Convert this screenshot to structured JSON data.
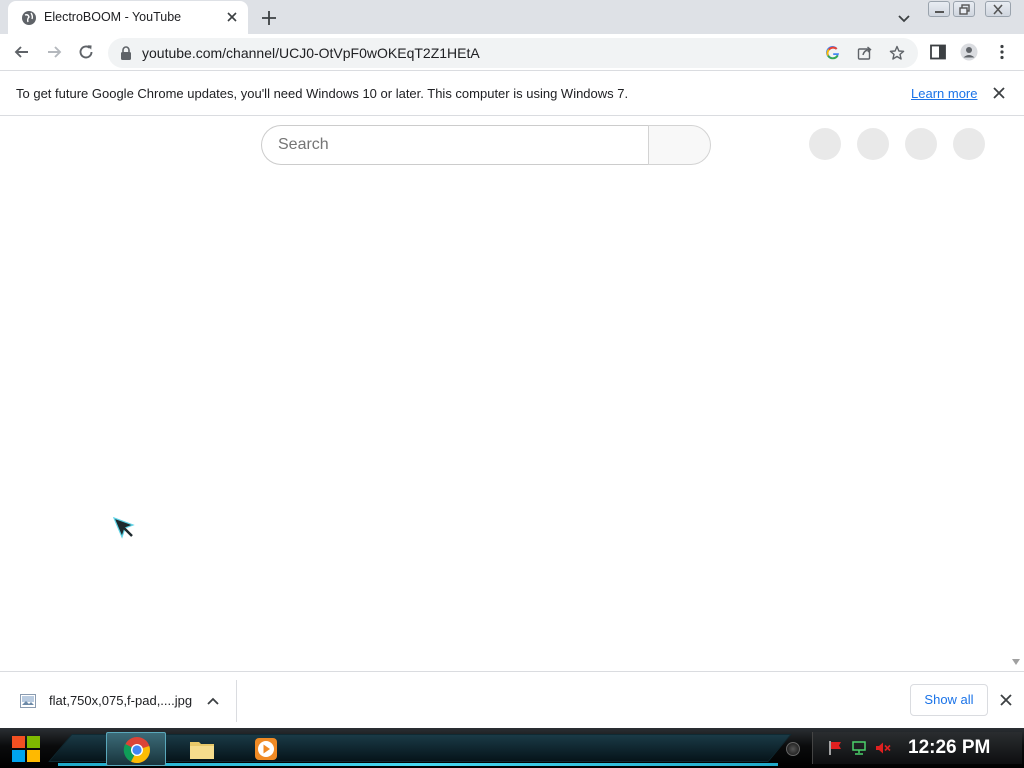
{
  "browser": {
    "tab": {
      "title": "ElectroBOOM - YouTube"
    },
    "address_bar": {
      "url": "youtube.com/channel/UCJ0-OtVpF0wOKEqT2Z1HEtA"
    }
  },
  "infobar": {
    "message": "To get future Google Chrome updates, you'll need Windows 10 or later. This computer is using Windows 7.",
    "learn_more": "Learn more"
  },
  "page": {
    "search": {
      "placeholder": "Search"
    }
  },
  "download_shelf": {
    "file_name": "flat,750x,075,f-pad,....jpg",
    "show_all": "Show all"
  },
  "taskbar": {
    "clock": "12:26 PM"
  },
  "colors": {
    "link": "#1a73e8",
    "tab_strip": "#dee1e6"
  }
}
